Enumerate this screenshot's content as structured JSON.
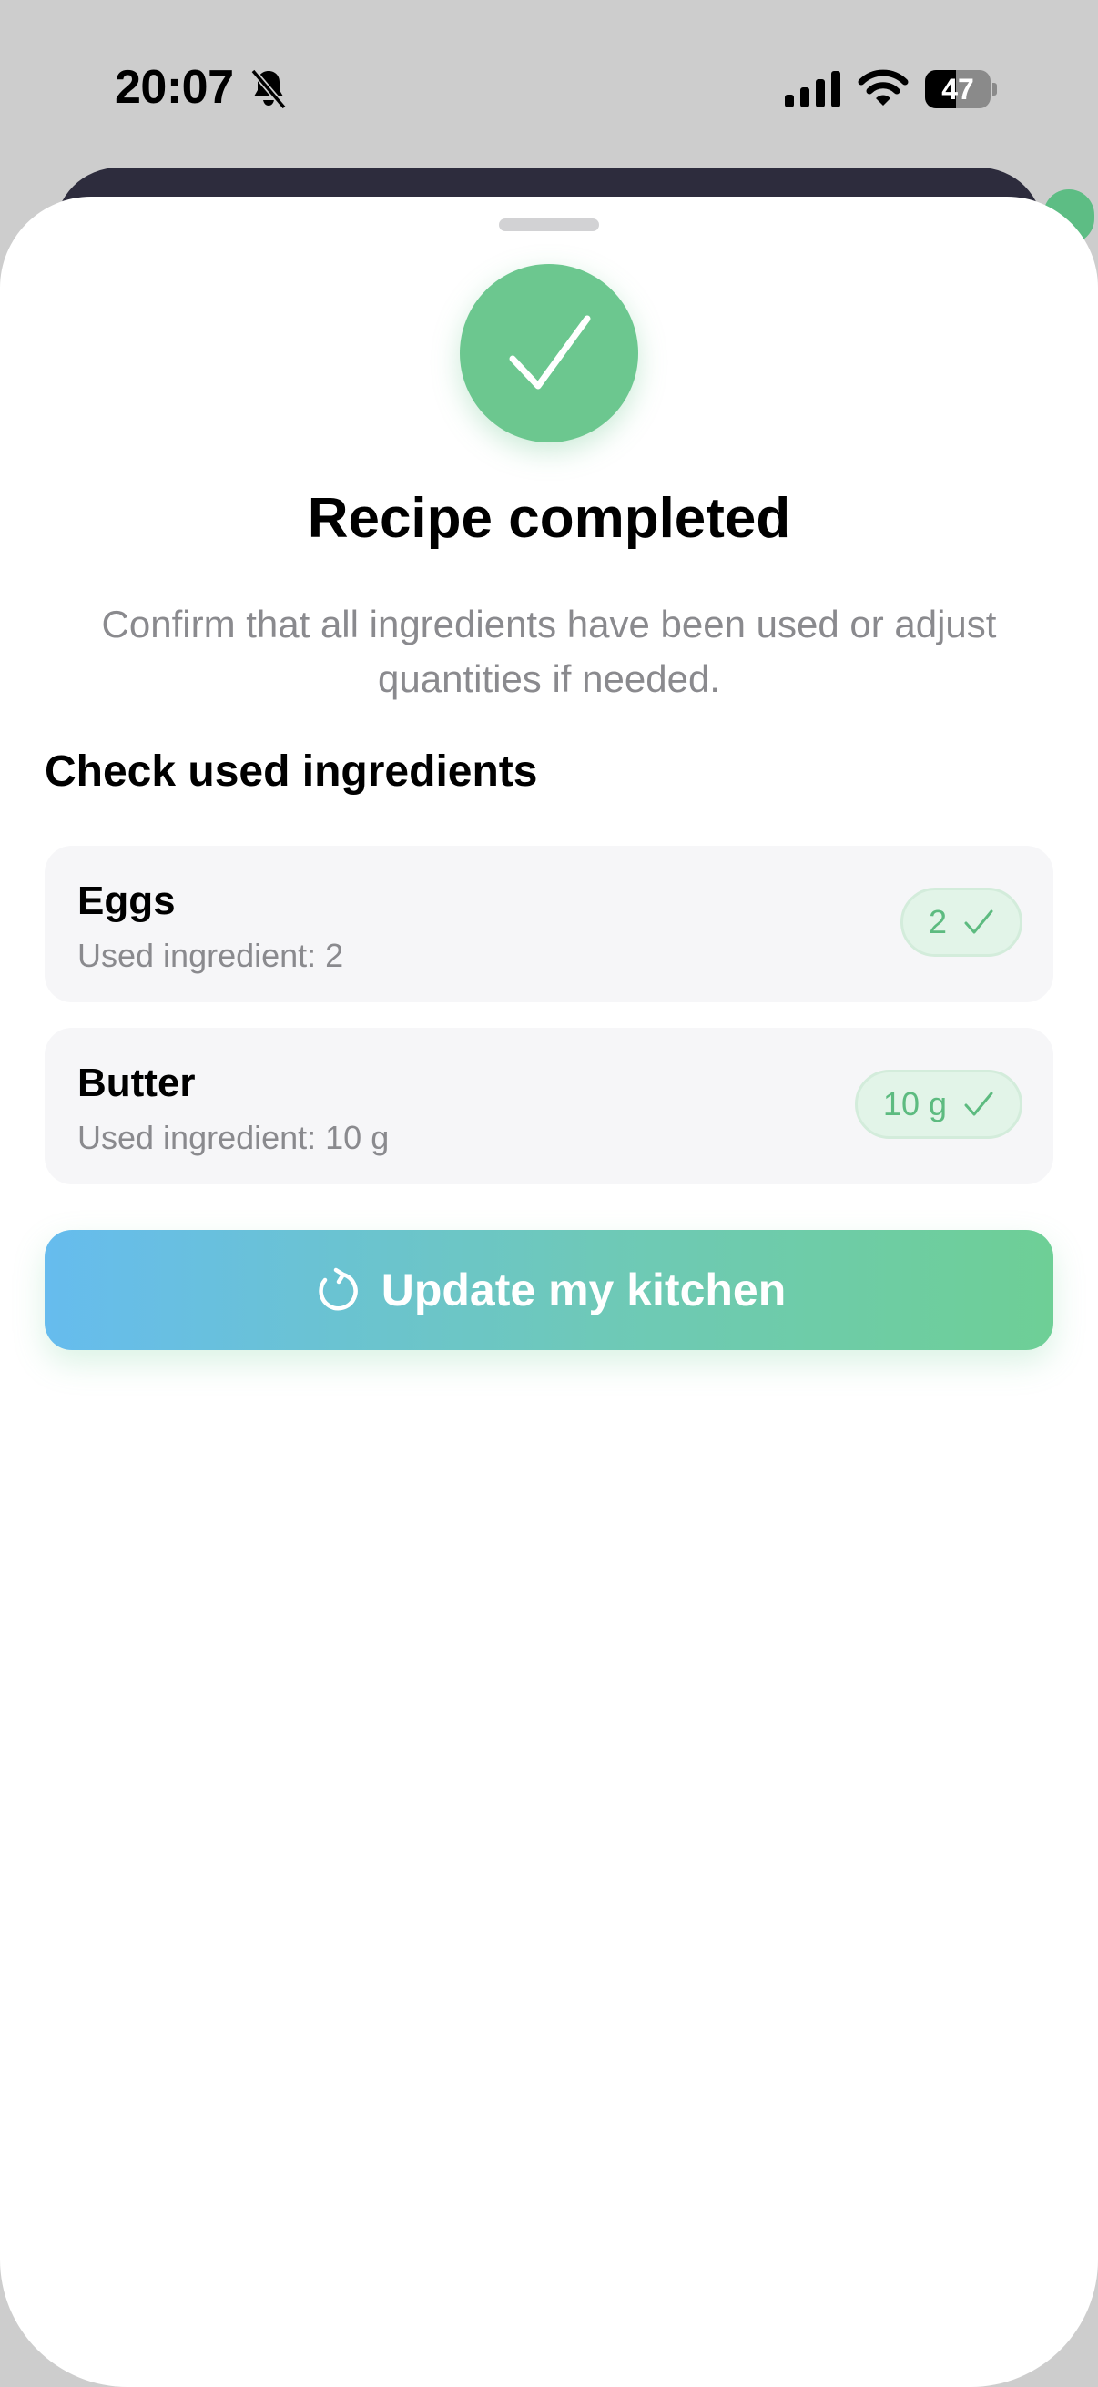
{
  "status_bar": {
    "time": "20:07",
    "battery_level": "47",
    "battery_fraction": 0.47,
    "icons": [
      "bell-slash-icon",
      "cellular-signal-icon",
      "wifi-icon",
      "battery-icon"
    ]
  },
  "sheet": {
    "success_icon": "checkmark-icon",
    "title": "Recipe completed",
    "subtitle": "Confirm that all ingredients have been used or adjust quantities if needed.",
    "section_title": "Check used ingredients",
    "ingredients": [
      {
        "name": "Eggs",
        "used_text": "Used ingredient: 2",
        "quantity": "2"
      },
      {
        "name": "Butter",
        "used_text": "Used ingredient: 10 g",
        "quantity": "10 g"
      }
    ],
    "button": {
      "icon": "refresh-icon",
      "label": "Update my kitchen"
    }
  },
  "colors": {
    "accent_green": "#6cc78f",
    "button_gradient_start": "#66bcee",
    "button_gradient_end": "#6ecf96",
    "pill_background": "#e2f4e8",
    "pill_text": "#5dbb80",
    "secondary_text": "#8a8a8e",
    "card_background": "#f6f6f8"
  }
}
